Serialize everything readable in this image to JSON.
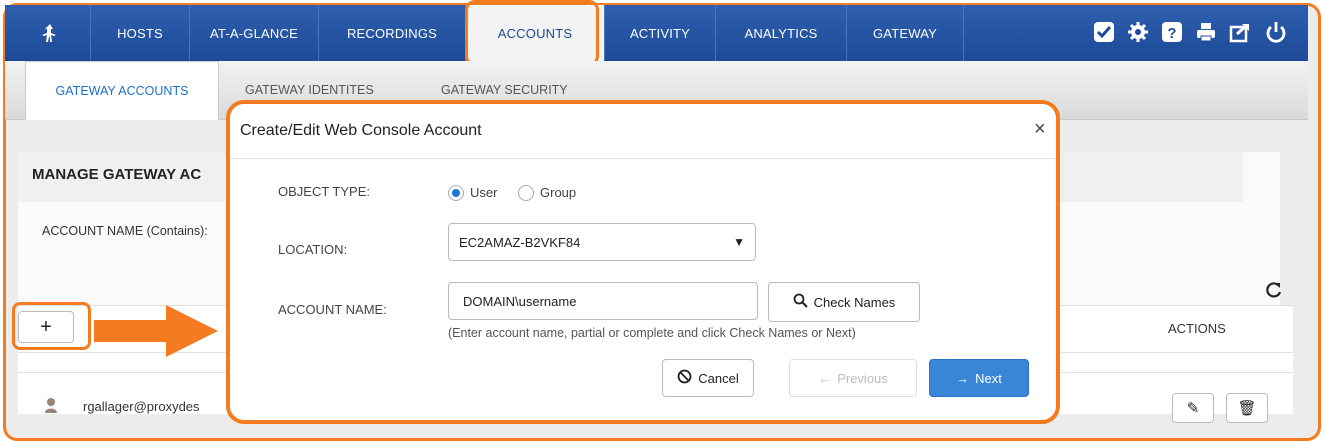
{
  "nav": {
    "home_icon": "figure-icon",
    "items": [
      {
        "label": "HOSTS"
      },
      {
        "label": "AT-A-GLANCE"
      },
      {
        "label": "RECORDINGS"
      },
      {
        "label": "ACCOUNTS"
      },
      {
        "label": "ACTIVITY"
      },
      {
        "label": "ANALYTICS"
      },
      {
        "label": "GATEWAY"
      }
    ],
    "active": "ACCOUNTS",
    "utility_icons": [
      "checkbox-icon",
      "gear-icon",
      "help-icon",
      "print-icon",
      "share-icon",
      "power-icon"
    ]
  },
  "subnav": {
    "tabs": [
      {
        "label": "GATEWAY ACCOUNTS"
      },
      {
        "label": "GATEWAY IDENTITES"
      },
      {
        "label": "GATEWAY SECURITY"
      }
    ],
    "active": "GATEWAY ACCOUNTS"
  },
  "page": {
    "title": "MANAGE GATEWAY AC",
    "filter_label": "ACCOUNT NAME (Contains):",
    "actions_header": "ACTIONS",
    "row_user": "rgallager@proxydes"
  },
  "modal": {
    "title": "Create/Edit Web Console Account",
    "close": "×",
    "object_type_label": "OBJECT TYPE:",
    "object_type_options": [
      "User",
      "Group"
    ],
    "object_type_selected": "User",
    "location_label": "LOCATION:",
    "location_value": "EC2AMAZ-B2VKF84",
    "account_name_label": "ACCOUNT NAME:",
    "account_name_value": "DOMAIN\\username",
    "check_names_label": "Check Names",
    "hint": "(Enter account name, partial or complete and click Check Names or Next)",
    "cancel_label": "Cancel",
    "previous_label": "Previous",
    "next_label": "Next"
  },
  "colors": {
    "accent": "#f47b20",
    "nav_blue": "#1c4a99",
    "primary_button": "#3a86d6"
  }
}
